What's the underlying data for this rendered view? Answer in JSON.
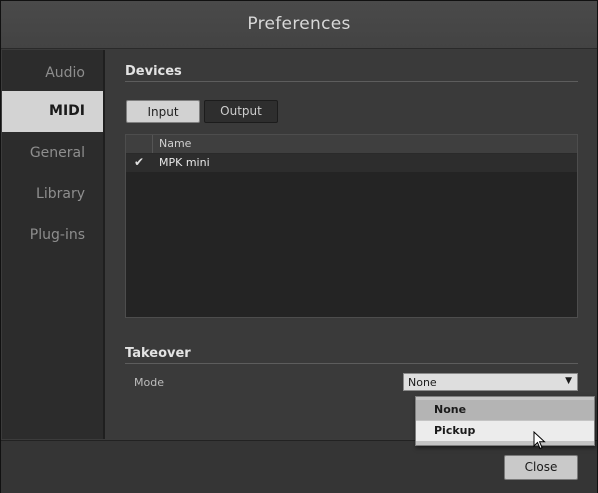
{
  "window": {
    "title": "Preferences"
  },
  "sidebar": {
    "items": [
      {
        "label": "Audio"
      },
      {
        "label": "MIDI"
      },
      {
        "label": "General"
      },
      {
        "label": "Library"
      },
      {
        "label": "Plug-ins"
      }
    ],
    "active": "MIDI"
  },
  "devices": {
    "section_title": "Devices",
    "tabs": {
      "input_label": "Input",
      "output_label": "Output",
      "active": "Input"
    },
    "table": {
      "columns": [
        "",
        "Name"
      ],
      "rows": [
        {
          "checked": true,
          "check_glyph": "✔",
          "name": "MPK mini"
        }
      ]
    }
  },
  "takeover": {
    "section_title": "Takeover",
    "mode_label": "Mode",
    "mode_value": "None",
    "dropdown_arrow": "▼",
    "options": [
      {
        "label": "None"
      },
      {
        "label": "Pickup"
      }
    ]
  },
  "footer": {
    "close_label": "Close"
  },
  "colors": {
    "active_highlight": "#d3d3d3",
    "background": "#3a3a3a",
    "sidebar": "#2c2c2c"
  }
}
